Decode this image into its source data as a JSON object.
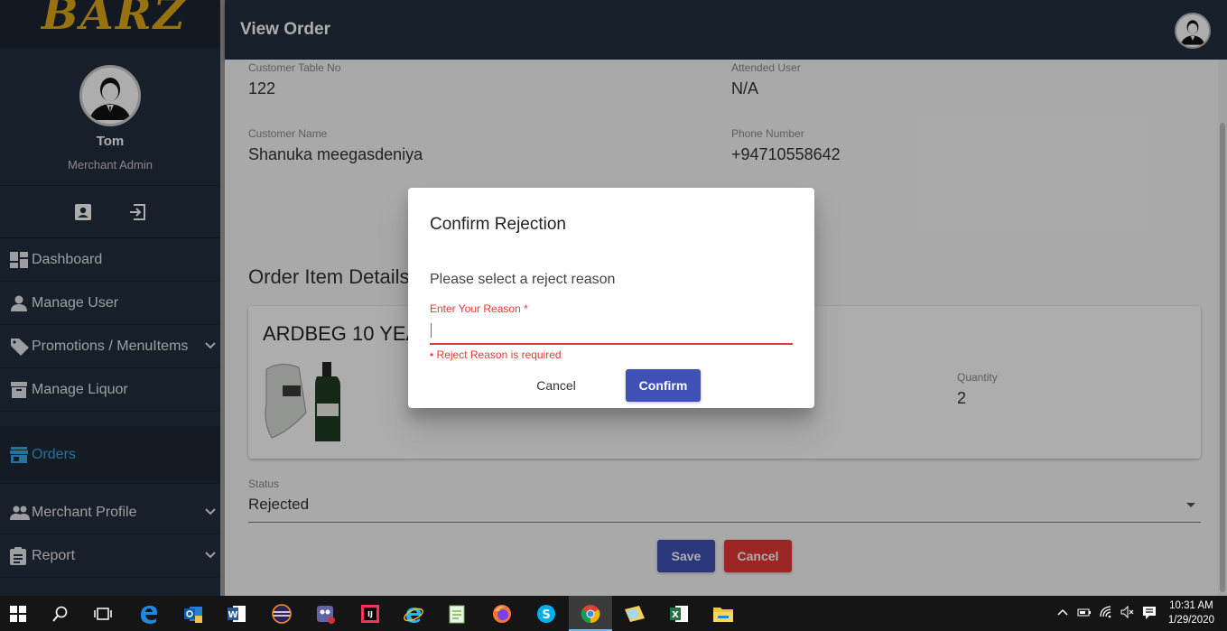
{
  "app": {
    "logo_text": "BARZ",
    "page_title": "View Order"
  },
  "sidebar": {
    "user_name": "Tom",
    "user_role": "Merchant Admin",
    "items": [
      {
        "label": "Dashboard",
        "icon": "dashboard-icon",
        "expandable": false
      },
      {
        "label": "Manage User",
        "icon": "person-icon",
        "expandable": false
      },
      {
        "label": "Promotions / MenuItems",
        "icon": "tag-icon",
        "expandable": true
      },
      {
        "label": "Manage Liquor",
        "icon": "liquor-icon",
        "expandable": false
      },
      {
        "label": "Orders",
        "icon": "store-icon",
        "expandable": false,
        "active": true
      },
      {
        "label": "Merchant Profile",
        "icon": "people-icon",
        "expandable": true
      },
      {
        "label": "Report",
        "icon": "clipboard-icon",
        "expandable": true
      }
    ]
  },
  "order": {
    "table_label": "Customer Table No",
    "table_value": "122",
    "attended_label": "Attended User",
    "attended_value": "N/A",
    "name_label": "Customer Name",
    "name_value": "Shanuka meegasdeniya",
    "phone_label": "Phone Number",
    "phone_value": "+94710558642",
    "items_title": "Order Item Details",
    "item_name": "ARDBEG 10 YEARS",
    "quantity_label": "Quantity",
    "quantity_value": "2",
    "status_label": "Status",
    "status_value": "Rejected",
    "save_label": "Save",
    "cancel_label": "Cancel"
  },
  "dialog": {
    "title": "Confirm Rejection",
    "message": "Please select a reject reason",
    "input_label": "Enter Your Reason *",
    "input_value": "",
    "error": "• Reject Reason is required",
    "cancel_label": "Cancel",
    "confirm_label": "Confirm"
  },
  "taskbar": {
    "time": "10:31 AM",
    "date": "1/29/2020"
  },
  "colors": {
    "sidebar_bg": "#232f3e",
    "accent": "#3f51b5",
    "danger": "#e53935",
    "active_nav": "#38a7e8",
    "logo": "#e0a815"
  }
}
